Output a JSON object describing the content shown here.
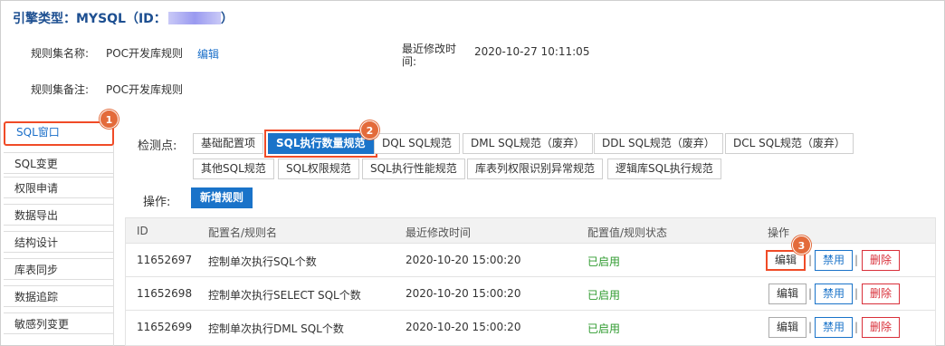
{
  "header": {
    "title": "引擎类型：MYSQL（ID：",
    "title_suffix": "）"
  },
  "info": {
    "ruleset_name_label": "规则集名称:",
    "ruleset_name_value": "POC开发库规则",
    "edit_link": "编辑",
    "modified_label_line1": "最近修改时",
    "modified_label_line2": "间:",
    "modified_value": "2020-10-27 10:11:05",
    "remark_label": "规则集备注:",
    "remark_value": "POC开发库规则"
  },
  "sidebar": {
    "items": [
      {
        "label": "SQL窗口",
        "active": true
      },
      {
        "label": "SQL变更"
      },
      {
        "label": "权限申请"
      },
      {
        "label": "数据导出"
      },
      {
        "label": "结构设计"
      },
      {
        "label": "库表同步"
      },
      {
        "label": "数据追踪"
      },
      {
        "label": "敏感列变更"
      }
    ]
  },
  "checkpoints": {
    "label": "检测点:",
    "items": [
      {
        "label": "基础配置项"
      },
      {
        "label": "SQL执行数量规范",
        "active": true
      },
      {
        "label": "DQL SQL规范"
      },
      {
        "label": "DML SQL规范（废弃）"
      },
      {
        "label": "DDL SQL规范（废弃）"
      },
      {
        "label": "DCL SQL规范（废弃）"
      },
      {
        "label": "其他SQL规范"
      },
      {
        "label": "SQL权限规范"
      },
      {
        "label": "SQL执行性能规范"
      },
      {
        "label": "库表列权限识别异常规范"
      },
      {
        "label": "逻辑库SQL执行规范"
      }
    ]
  },
  "actions": {
    "label": "操作:",
    "new_rule_button": "新增规则"
  },
  "table": {
    "columns": [
      "ID",
      "配置名/规则名",
      "最近修改时间",
      "配置值/规则状态",
      "操作"
    ],
    "rows": [
      {
        "id": "11652697",
        "name": "控制单次执行SQL个数",
        "modified": "2020-10-20 15:00:20",
        "status": "已启用"
      },
      {
        "id": "11652698",
        "name": "控制单次执行SELECT SQL个数",
        "modified": "2020-10-20 15:00:20",
        "status": "已启用"
      },
      {
        "id": "11652699",
        "name": "控制单次执行DML SQL个数",
        "modified": "2020-10-20 15:00:20",
        "status": "已启用"
      }
    ],
    "row_actions": {
      "edit": "编辑",
      "disable": "禁用",
      "delete": "删除",
      "separator": "|"
    }
  },
  "callouts": {
    "one": "1",
    "two": "2",
    "three": "3"
  },
  "colors": {
    "accent": "#1a73c9",
    "callout": "#e36b3b",
    "highlight_border": "#f04b27",
    "enabled": "#2e9a2e",
    "title": "#1d4f91"
  }
}
